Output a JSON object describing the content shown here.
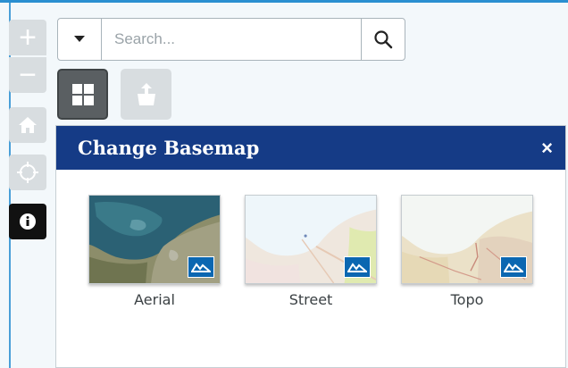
{
  "map_controls": {
    "zoom_in_label": "+",
    "zoom_out_label": "−",
    "home_icon": "home-icon",
    "locate_icon": "locate-icon",
    "info_icon": "info-icon"
  },
  "search": {
    "dropdown_icon": "chevron-down-icon",
    "placeholder": "Search...",
    "value": "",
    "submit_icon": "search-icon"
  },
  "widgets": {
    "basemap_icon": "grid-icon",
    "share_icon": "share-icon"
  },
  "basemap_panel": {
    "title": "Change Basemap",
    "close_label": "×",
    "items": [
      {
        "label": "Aerial",
        "icon": "basemap-logo-icon"
      },
      {
        "label": "Street",
        "icon": "basemap-logo-icon"
      },
      {
        "label": "Topo",
        "icon": "basemap-logo-icon"
      }
    ]
  },
  "colors": {
    "header_bg": "#153b86",
    "accent_blue": "#2a8fd1",
    "logo_blue": "#0b67b1",
    "active_button": "#5a5f62",
    "inactive_button": "#d8dde0"
  }
}
